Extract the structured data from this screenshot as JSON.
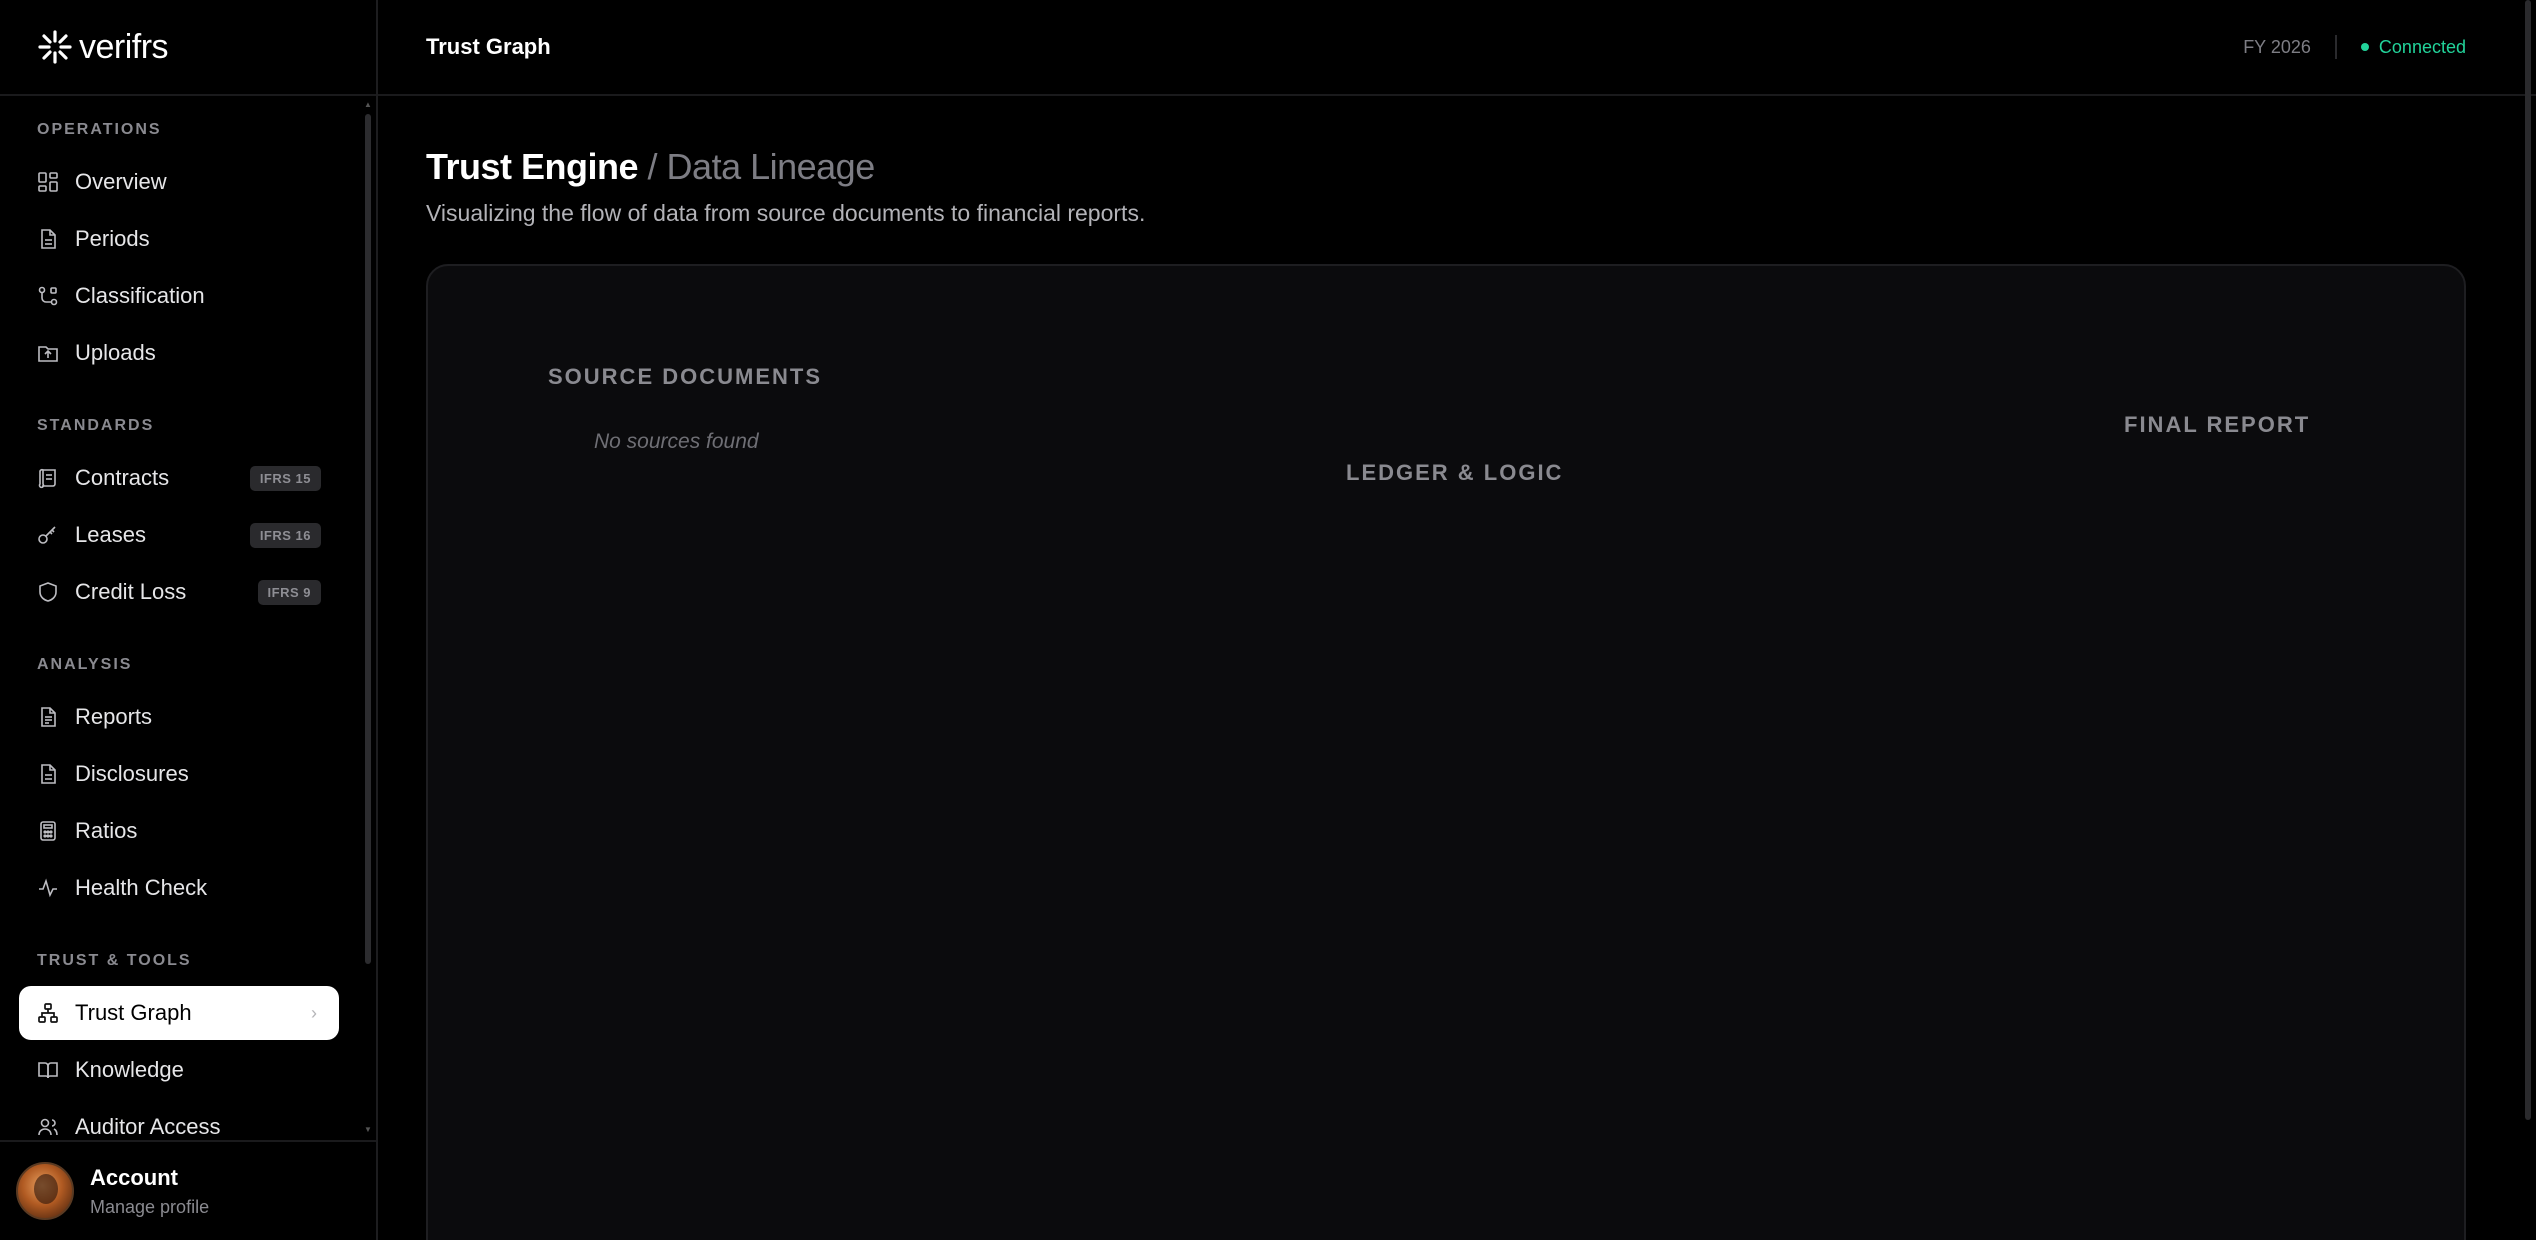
{
  "brand": {
    "name": "verifrs"
  },
  "sidebar": {
    "sections": [
      {
        "label": "OPERATIONS",
        "items": [
          {
            "label": "Overview",
            "icon": "grid-icon"
          },
          {
            "label": "Periods",
            "icon": "document-icon"
          },
          {
            "label": "Classification",
            "icon": "branch-icon"
          },
          {
            "label": "Uploads",
            "icon": "folder-upload-icon"
          }
        ]
      },
      {
        "label": "STANDARDS",
        "items": [
          {
            "label": "Contracts",
            "icon": "scroll-icon",
            "badge": "IFRS 15"
          },
          {
            "label": "Leases",
            "icon": "key-icon",
            "badge": "IFRS 16"
          },
          {
            "label": "Credit Loss",
            "icon": "shield-icon",
            "badge": "IFRS 9"
          }
        ]
      },
      {
        "label": "ANALYSIS",
        "items": [
          {
            "label": "Reports",
            "icon": "report-icon"
          },
          {
            "label": "Disclosures",
            "icon": "document-icon"
          },
          {
            "label": "Ratios",
            "icon": "calculator-icon"
          },
          {
            "label": "Health Check",
            "icon": "pulse-icon"
          }
        ]
      },
      {
        "label": "TRUST & TOOLS",
        "items": [
          {
            "label": "Trust Graph",
            "icon": "network-icon",
            "active": true
          },
          {
            "label": "Knowledge",
            "icon": "book-icon"
          },
          {
            "label": "Auditor Access",
            "icon": "users-icon"
          }
        ]
      }
    ]
  },
  "account": {
    "name": "Account",
    "subtitle": "Manage profile"
  },
  "topbar": {
    "title": "Trust Graph",
    "fiscal_year": "FY 2026",
    "status": "Connected"
  },
  "page": {
    "title": "Trust Engine",
    "title_suffix": "/ Data Lineage",
    "description": "Visualizing the flow of data from source documents to financial reports."
  },
  "graph": {
    "source_label": "SOURCE DOCUMENTS",
    "source_empty": "No sources found",
    "ledger_label": "LEDGER & LOGIC",
    "report_label": "FINAL REPORT"
  },
  "colors": {
    "accent": "#22d39a",
    "background": "#000000",
    "card": "#0b0b0d"
  }
}
